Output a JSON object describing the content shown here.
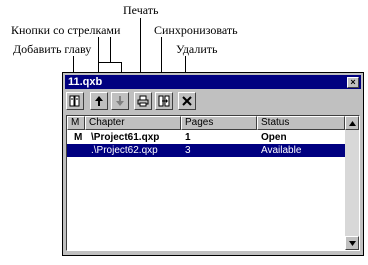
{
  "annotations": {
    "print": "Печать",
    "arrows": "Кнопки со стрелками",
    "sync": "Синхронизовать",
    "add": "Добавить главу",
    "delete": "Удалить"
  },
  "window": {
    "title": "11.qxb",
    "close": "×"
  },
  "toolbar": {
    "buttons": [
      {
        "name": "add-chapter",
        "icon": "book-icon"
      },
      {
        "name": "move-up",
        "icon": "arrow-up-icon"
      },
      {
        "name": "move-down",
        "icon": "arrow-down-icon"
      },
      {
        "name": "print",
        "icon": "printer-icon"
      },
      {
        "name": "synchronize",
        "icon": "sync-icon"
      },
      {
        "name": "delete",
        "icon": "x-icon"
      }
    ]
  },
  "list": {
    "columns": [
      "M",
      "Chapter",
      "Pages",
      "Status"
    ],
    "rows": [
      {
        "marker": "M",
        "chapter": "\\Project61.qxp",
        "pages": "1",
        "status": "Open"
      },
      {
        "marker": "",
        "chapter": ".\\Project62.qxp",
        "pages": "3",
        "status": "Available"
      }
    ]
  }
}
